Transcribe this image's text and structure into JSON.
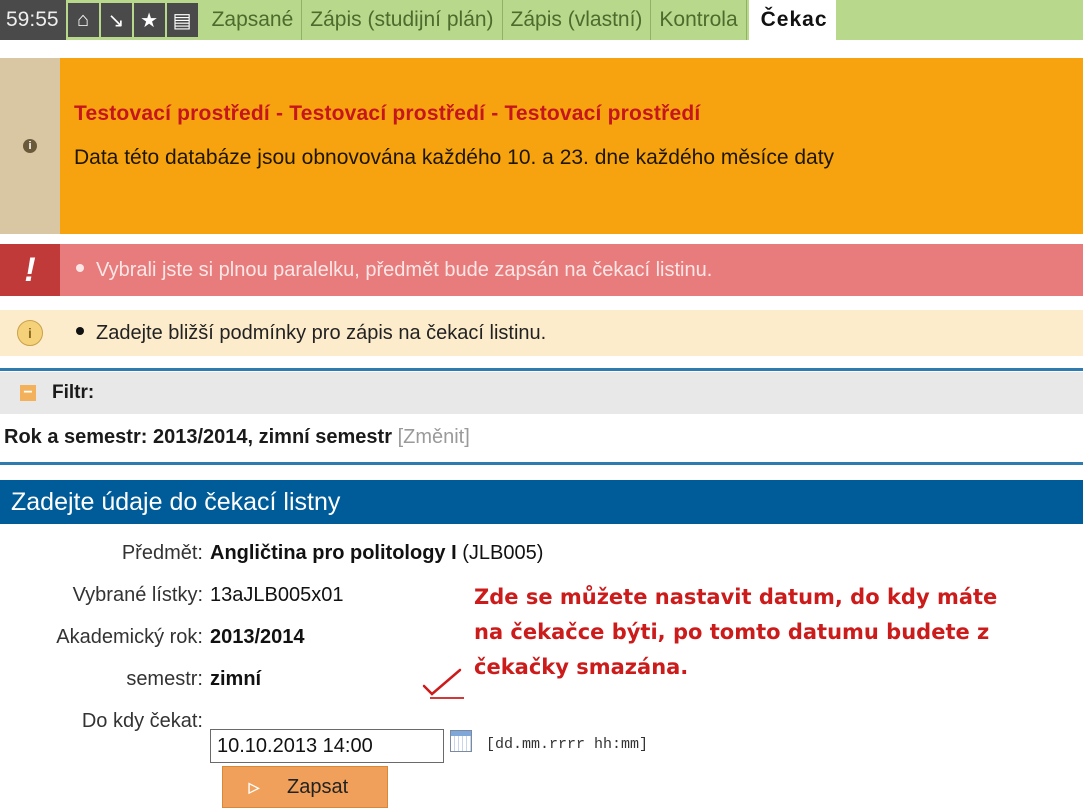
{
  "topnav": {
    "timer": "59:55",
    "icons": [
      "home-icon",
      "download-icon",
      "star-icon",
      "print-icon"
    ],
    "tabs": [
      "Zapsané",
      "Zápis (studijní plán)",
      "Zápis (vlastní)",
      "Kontrola"
    ],
    "active_tab": "Čekac"
  },
  "banner": {
    "title": "Testovací prostředí - Testovací prostředí - Testovací prostředí",
    "text": "Data této databáze jsou obnovována každého 10. a 23. dne každého měsíce daty"
  },
  "messages": {
    "error": "Vybrali jste si plnou paralelku, předmět bude zapsán na čekací listinu.",
    "info": "Zadejte bližší podmínky pro zápis na čekací listinu."
  },
  "filter": {
    "title": "Filtr:",
    "label": "Rok a semestr: 2013/2014, zimní semestr",
    "change_link": "[Změnit]"
  },
  "form": {
    "title": "Zadejte údaje do čekací listny",
    "subject_label": "Předmět:",
    "subject_name": "Angličtina pro politology I",
    "subject_code": "(JLB005)",
    "tickets_label": "Vybrané lístky:",
    "tickets_value": "13aJLB005x01",
    "year_label": "Akademický rok:",
    "year_value": "2013/2014",
    "semester_label": "semestr:",
    "semester_value": "zimní",
    "wait_label": "Do kdy čekat:",
    "wait_value": "10.10.2013 14:00",
    "date_format": "[dd.mm.rrrr hh:mm]",
    "submit_label": "Zapsat"
  },
  "annotation": {
    "lines": [
      "Zde se můžete nastavit datum, do kdy máte",
      "na čekačce býti, po tomto datumu budete z",
      "čekačky smazána."
    ],
    "color": "#cc1b1b"
  },
  "colors": {
    "nav_bg": "#b8d88c",
    "banner_bg": "#f7a30f",
    "banner_title": "#c4161c",
    "error_bg": "#e87c7c",
    "info_bg": "#fdeccb",
    "form_header": "#005b99",
    "submit_bg": "#f0a05a"
  }
}
